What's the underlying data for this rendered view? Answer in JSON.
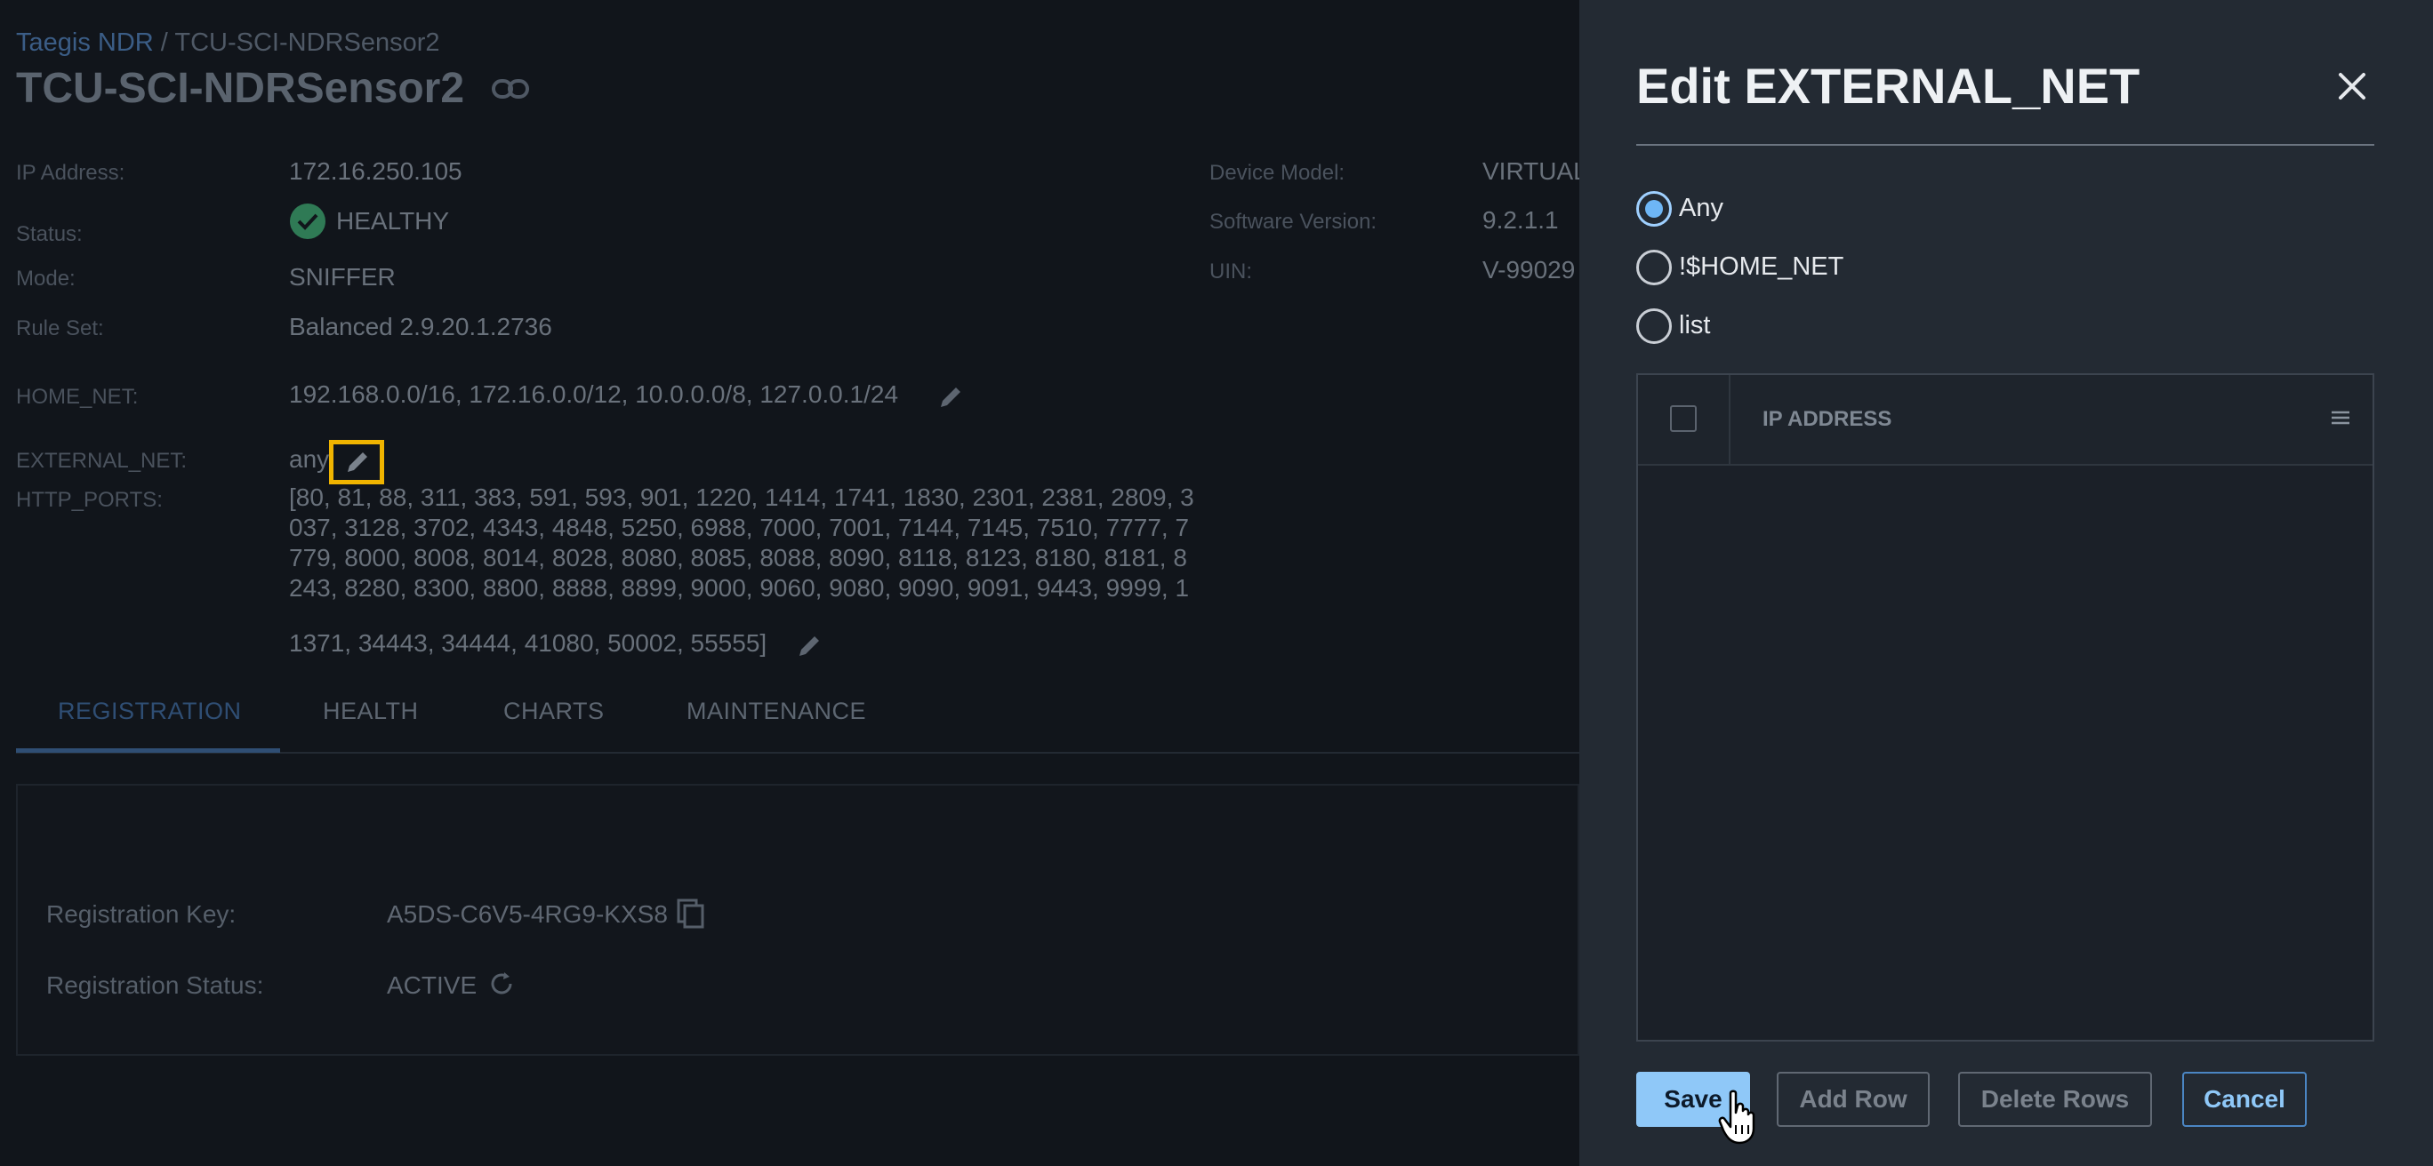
{
  "breadcrumb": {
    "root": "Taegis NDR",
    "separator": "/",
    "current": "TCU-SCI-NDRSensor2"
  },
  "page_title": "TCU-SCI-NDRSensor2",
  "details": {
    "ip_label": "IP Address:",
    "ip_value": "172.16.250.105",
    "status_label": "Status:",
    "status_value": "HEALTHY",
    "mode_label": "Mode:",
    "mode_value": "SNIFFER",
    "ruleset_label": "Rule Set:",
    "ruleset_value": "Balanced 2.9.20.1.2736",
    "home_net_label": "HOME_NET:",
    "home_net_value": "192.168.0.0/16, 172.16.0.0/12, 10.0.0.0/8, 127.0.0.1/24",
    "external_net_label": "EXTERNAL_NET:",
    "external_net_value": "any",
    "http_ports_label": "HTTP_PORTS:",
    "http_ports_value": "[80, 81, 88, 311, 383, 591, 593, 901, 1220, 1414, 1741, 1830, 2301, 2381, 2809, 3037, 3128, 3702, 4343, 4848, 5250, 6988, 7000, 7001, 7144, 7145, 7510, 7777, 7779, 8000, 8008, 8014, 8028, 8080, 8085, 8088, 8090, 8118, 8123, 8180, 8181, 8243, 8280, 8300, 8800, 8888, 8899, 9000, 9060, 9080, 9090, 9091, 9443, 9999, 1",
    "http_ports_tail": "1371, 34443, 34444, 41080, 50002, 55555]",
    "device_model_label": "Device Model:",
    "device_model_value": "VIRTUAL",
    "software_label": "Software Version:",
    "software_value": "9.2.1.1",
    "uin_label": "UIN:",
    "uin_value": "V-99029"
  },
  "tabs": [
    "REGISTRATION",
    "HEALTH",
    "CHARTS",
    "MAINTENANCE"
  ],
  "registration": {
    "key_label": "Registration Key:",
    "key_value": "A5DS-C6V5-4RG9-KXS8",
    "status_label": "Registration Status:",
    "status_value": "ACTIVE"
  },
  "modal": {
    "title": "Edit EXTERNAL_NET",
    "options": [
      "Any",
      "!$HOME_NET",
      "list"
    ],
    "selected_option": "Any",
    "grid_column": "IP ADDRESS",
    "buttons": {
      "save": "Save",
      "add_row": "Add Row",
      "delete_rows": "Delete Rows",
      "cancel": "Cancel"
    }
  },
  "colors": {
    "accent": "#8fc8f8",
    "healthy": "#2f7a55",
    "highlight": "#f0b400",
    "modal_bg": "#232a33"
  },
  "icons": [
    "link-icon",
    "check-circle-icon",
    "pencil-icon",
    "copy-icon",
    "refresh-icon",
    "close-icon",
    "column-menu-icon",
    "hand-cursor-icon"
  ]
}
